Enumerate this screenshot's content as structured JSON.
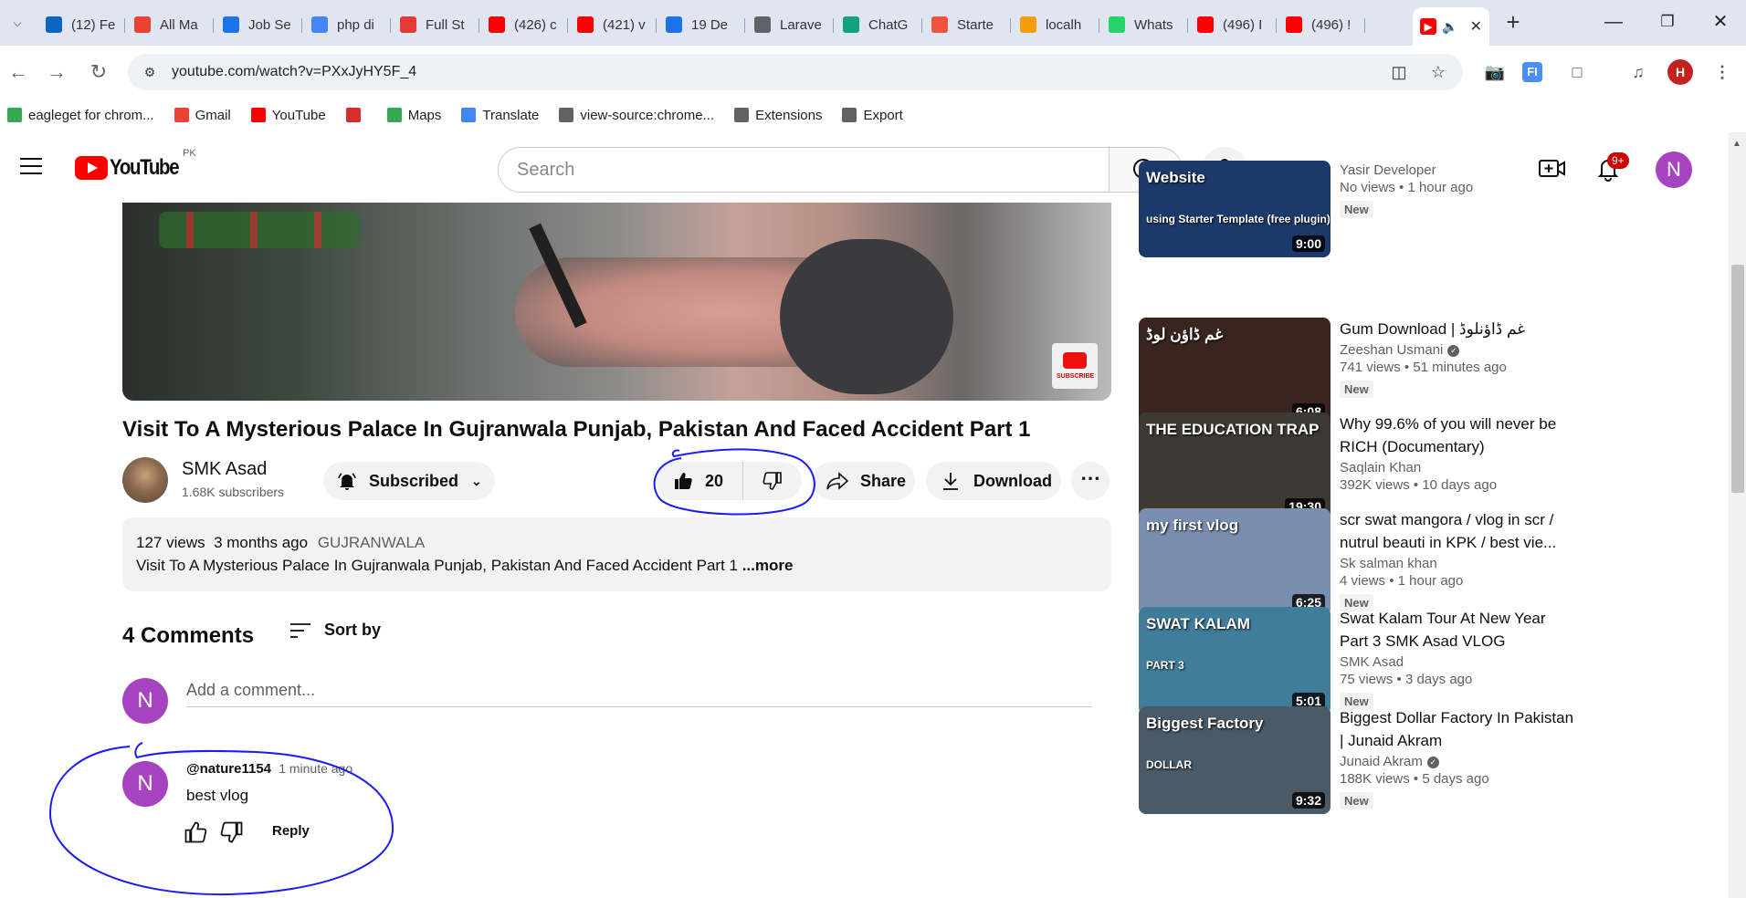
{
  "browser": {
    "tabs": [
      {
        "label": "(12) Fe",
        "icon": "linkedin-icon",
        "color": "#0a66c2"
      },
      {
        "label": "All Ma",
        "icon": "gmail-icon",
        "color": "#ea4335"
      },
      {
        "label": "Job Se",
        "icon": "info-icon",
        "color": "#1a73e8"
      },
      {
        "label": "php di",
        "icon": "google-icon",
        "color": "#4285f4"
      },
      {
        "label": "Full St",
        "icon": "flame-icon",
        "color": "#e53935"
      },
      {
        "label": "(426) c",
        "icon": "youtube-icon",
        "color": "#ff0000"
      },
      {
        "label": "(421) v",
        "icon": "youtube-icon",
        "color": "#ff0000"
      },
      {
        "label": "19 De",
        "icon": "info-icon",
        "color": "#1a73e8"
      },
      {
        "label": "Larave",
        "icon": "globe-icon",
        "color": "#5f6368"
      },
      {
        "label": "ChatG",
        "icon": "chatgpt-icon",
        "color": "#10a37f"
      },
      {
        "label": "Starte",
        "icon": "laravel-icon",
        "color": "#f05340"
      },
      {
        "label": "localh",
        "icon": "phpmyadmin-icon",
        "color": "#f89c0e"
      },
      {
        "label": "Whats",
        "icon": "whatsapp-icon",
        "color": "#25d366"
      },
      {
        "label": "(496) I",
        "icon": "youtube-icon",
        "color": "#ff0000"
      },
      {
        "label": "(496) !",
        "icon": "youtube-icon",
        "color": "#ff0000"
      }
    ],
    "active_tab_icons": [
      "youtube-icon",
      "speaker-icon"
    ],
    "url": "youtube.com/watch?v=PXxJyHY5F_4",
    "profile_initial": "H",
    "bookmarks": [
      {
        "label": "eagleget for chrom...",
        "icon": "play-store-icon",
        "color": "#34a853"
      },
      {
        "label": "Gmail",
        "icon": "gmail-icon",
        "color": "#ea4335"
      },
      {
        "label": "YouTube",
        "icon": "youtube-icon",
        "color": "#ff0000"
      },
      {
        "label": "",
        "icon": "fiverr-icon",
        "color": "#d32f2f"
      },
      {
        "label": "Maps",
        "icon": "maps-icon",
        "color": "#34a853"
      },
      {
        "label": "Translate",
        "icon": "translate-icon",
        "color": "#4285f4"
      },
      {
        "label": "view-source:chrome...",
        "icon": "globe-icon",
        "color": "#5f6368"
      },
      {
        "label": "Extensions",
        "icon": "puzzle-icon",
        "color": "#5f6368"
      },
      {
        "label": "Export",
        "icon": "globe-icon",
        "color": "#5f6368"
      }
    ]
  },
  "yt_header": {
    "logo_text": "YouTube",
    "region": "PK",
    "search_placeholder": "Search",
    "notifications": "9+",
    "avatar_initial": "N"
  },
  "video": {
    "title": "Visit To A Mysterious Palace In Gujranwala Punjab, Pakistan And Faced Accident Part 1",
    "channel_name": "SMK Asad",
    "subscribers": "1.68K subscribers",
    "subscribed_label": "Subscribed",
    "likes": "20",
    "share_label": "Share",
    "download_label": "Download",
    "views": "127 views",
    "date": "3 months ago",
    "location": "GUJRANWALA",
    "description": "Visit To A Mysterious Palace In Gujranwala Punjab, Pakistan And Faced Accident Part 1",
    "more_label": "...more"
  },
  "comments": {
    "count_label": "4 Comments",
    "sort_label": "Sort by",
    "add_placeholder": "Add a comment...",
    "my_initial": "N",
    "items": [
      {
        "initial": "N",
        "author": "@nature1154",
        "time": "1 minute ago",
        "text": "best vlog",
        "reply_label": "Reply"
      }
    ]
  },
  "recommendations": [
    {
      "title": "",
      "channel": "Yasir Developer",
      "verified": false,
      "views": "No views",
      "age": "1 hour ago",
      "badge": "New",
      "duration": "9:00",
      "thumb_text": "Website",
      "thumb_subtext": "using Starter Template (free plugin)",
      "thumb_color": "#1b3a6b"
    },
    {
      "title": "Gum Download | غم ڈاؤنلوڈ",
      "channel": "Zeeshan Usmani",
      "verified": true,
      "views": "741 views",
      "age": "51 minutes ago",
      "badge": "New",
      "duration": "6:08",
      "thumb_text": "غم ڈاؤن لوڈ",
      "thumb_color": "#3a2420"
    },
    {
      "title": "Why 99.6% of you will never be RICH (Documentary)",
      "channel": "Saqlain Khan",
      "verified": false,
      "views": "392K views",
      "age": "10 days ago",
      "badge": "",
      "duration": "19:30",
      "thumb_text": "THE EDUCATION TRAP",
      "thumb_color": "#3d3a34"
    },
    {
      "title": "scr swat mangora / vlog in scr / nutrul beauti in KPK / best vie...",
      "channel": "Sk salman khan",
      "verified": false,
      "views": "4 views",
      "age": "1 hour ago",
      "badge": "New",
      "duration": "6:25",
      "thumb_text": "my first vlog",
      "thumb_color": "#7a8fb0"
    },
    {
      "title": "Swat Kalam Tour At New Year Part 3 SMK Asad VLOG",
      "channel": "SMK Asad",
      "verified": false,
      "views": "75 views",
      "age": "3 days ago",
      "badge": "New",
      "duration": "5:01",
      "thumb_text": "SWAT KALAM",
      "thumb_subtext": "PART 3",
      "thumb_color": "#3f7d9a"
    },
    {
      "title": "Biggest Dollar Factory In Pakistan | Junaid Akram",
      "channel": "Junaid Akram",
      "verified": true,
      "views": "188K views",
      "age": "5 days ago",
      "badge": "New",
      "duration": "9:32",
      "thumb_text": "Biggest Factory",
      "thumb_subtext": "DOLLAR",
      "thumb_color": "#4a5a66"
    }
  ],
  "colors": {
    "annotation": "#1a1aff",
    "youtube_red": "#ff0000",
    "avatar_purple": "#a643c0"
  }
}
